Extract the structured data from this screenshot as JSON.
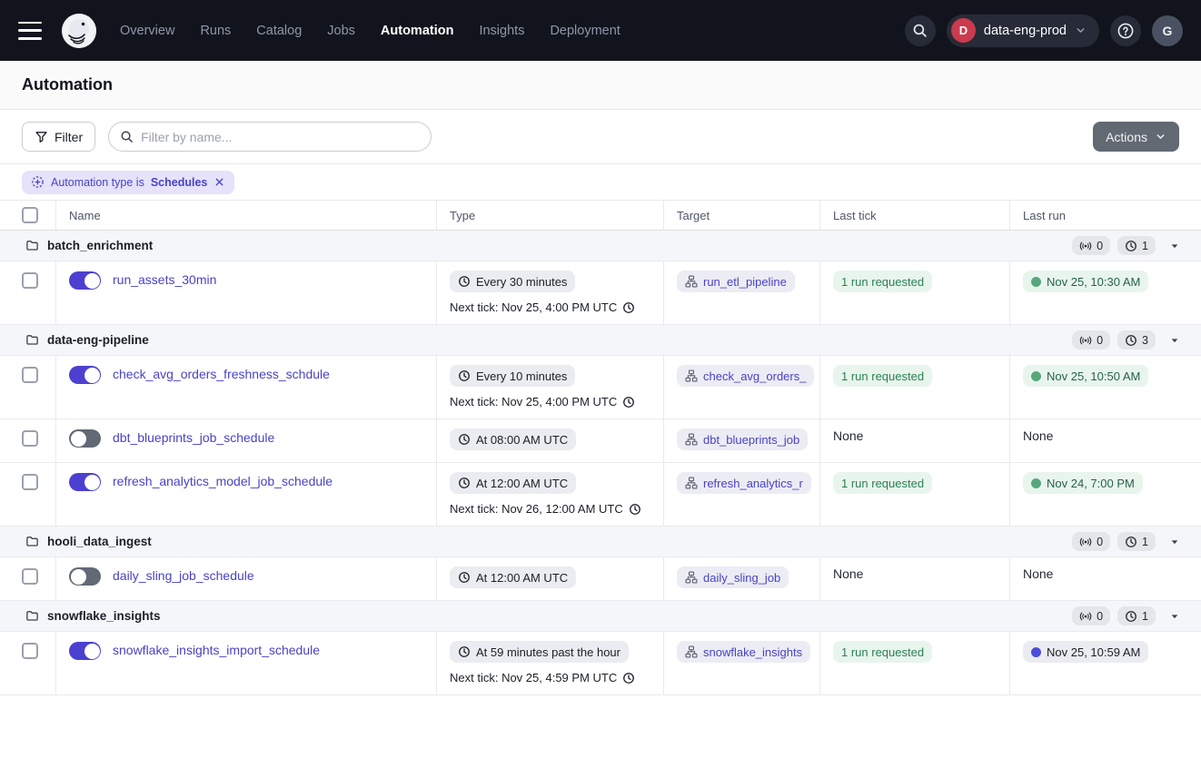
{
  "nav": {
    "items": [
      {
        "label": "Overview"
      },
      {
        "label": "Runs"
      },
      {
        "label": "Catalog"
      },
      {
        "label": "Jobs"
      },
      {
        "label": "Automation"
      },
      {
        "label": "Insights"
      },
      {
        "label": "Deployment"
      }
    ],
    "deployment": {
      "initial": "D",
      "name": "data-eng-prod"
    },
    "user_initial": "G"
  },
  "page": {
    "title": "Automation"
  },
  "toolbar": {
    "filter_label": "Filter",
    "search_placeholder": "Filter by name...",
    "actions_label": "Actions"
  },
  "filter_chip": {
    "prefix": "Automation type is",
    "value": "Schedules"
  },
  "table": {
    "headers": {
      "name": "Name",
      "type": "Type",
      "target": "Target",
      "last_tick": "Last tick",
      "last_run": "Last run"
    },
    "groups": [
      {
        "name": "batch_enrichment",
        "sensor_count": "0",
        "schedule_count": "1",
        "rows": [
          {
            "name": "run_assets_30min",
            "enabled": true,
            "type_badge": "Every 30 minutes",
            "next_tick": "Next tick: Nov 25, 4:00 PM UTC",
            "target": "run_etl_pipeline",
            "last_tick": "1 run requested",
            "last_run": "Nov 25, 10:30 AM"
          }
        ]
      },
      {
        "name": "data-eng-pipeline",
        "sensor_count": "0",
        "schedule_count": "3",
        "rows": [
          {
            "name": "check_avg_orders_freshness_schdule",
            "enabled": true,
            "type_badge": "Every 10 minutes",
            "next_tick": "Next tick: Nov 25, 4:00 PM UTC",
            "target": "check_avg_orders_",
            "last_tick": "1 run requested",
            "last_run": "Nov 25, 10:50 AM"
          },
          {
            "name": "dbt_blueprints_job_schedule",
            "enabled": false,
            "type_badge": "At 08:00 AM UTC",
            "target": "dbt_blueprints_job",
            "last_tick": "None",
            "last_run": "None"
          },
          {
            "name": "refresh_analytics_model_job_schedule",
            "enabled": true,
            "type_badge": "At 12:00 AM UTC",
            "next_tick": "Next tick: Nov 26, 12:00 AM UTC",
            "target": "refresh_analytics_r",
            "last_tick": "1 run requested",
            "last_run": "Nov 24, 7:00 PM"
          }
        ]
      },
      {
        "name": "hooli_data_ingest",
        "sensor_count": "0",
        "schedule_count": "1",
        "rows": [
          {
            "name": "daily_sling_job_schedule",
            "enabled": false,
            "type_badge": "At 12:00 AM UTC",
            "target": "daily_sling_job",
            "last_tick": "None",
            "last_run": "None"
          }
        ]
      },
      {
        "name": "snowflake_insights",
        "sensor_count": "0",
        "schedule_count": "1",
        "rows": [
          {
            "name": "snowflake_insights_import_schedule",
            "enabled": true,
            "type_badge": "At 59 minutes past the hour",
            "next_tick": "Next tick: Nov 25, 4:59 PM UTC",
            "target": "snowflake_insights",
            "last_tick": "1 run requested",
            "last_run": "Nov 25, 10:59 AM"
          }
        ]
      }
    ]
  }
}
